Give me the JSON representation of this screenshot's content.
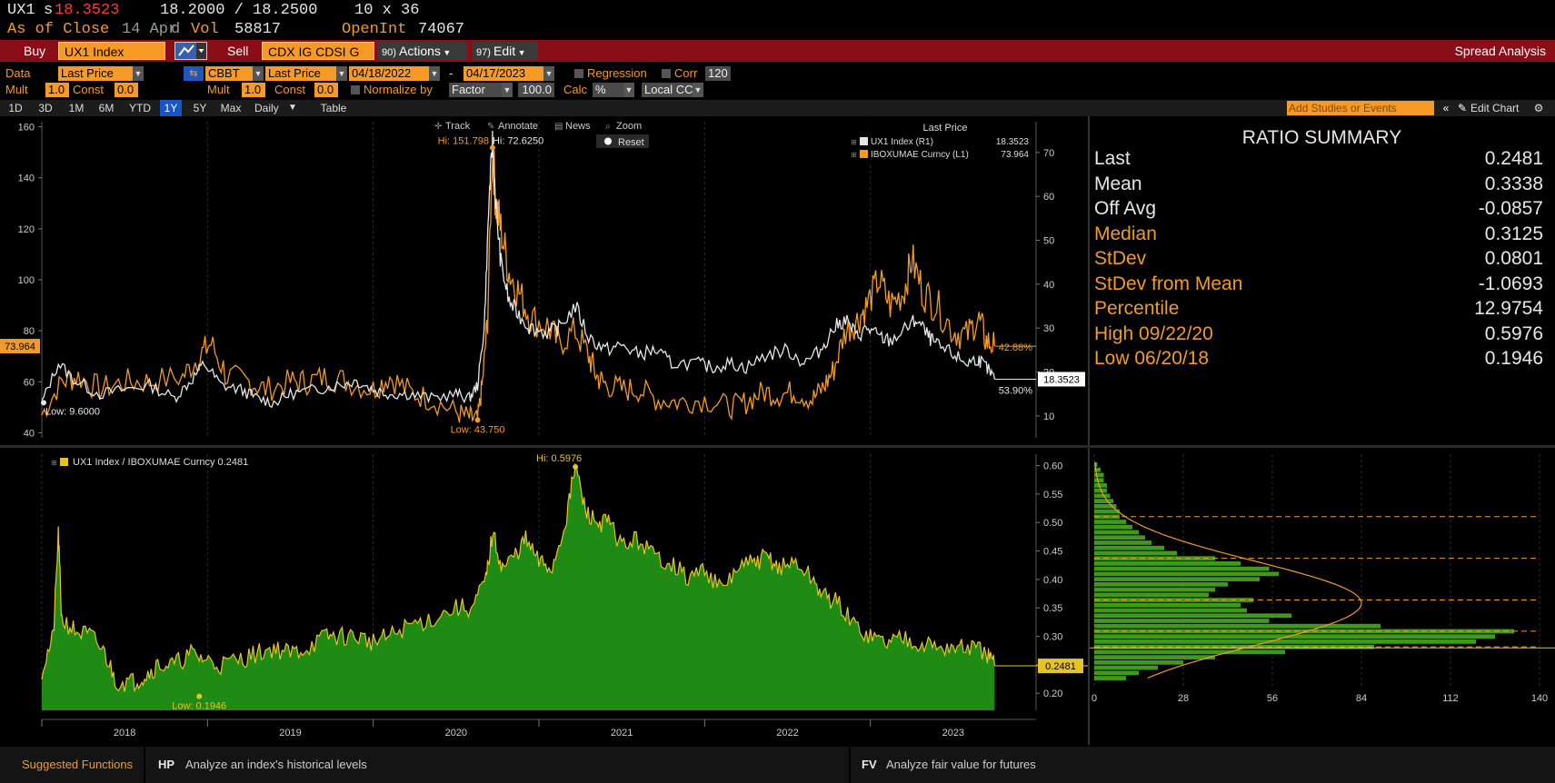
{
  "header": {
    "ticker": "UX1",
    "price_prefix": "s",
    "price": "18.3523",
    "bid_ask": "18.2000 / 18.2500",
    "size": "10 x 36",
    "close_label": "As of Close",
    "close_date": "14 Apr",
    "close_flag": "d",
    "vol_label": "Vol",
    "vol": "58817",
    "oi_label": "OpenInt",
    "oi": "74067"
  },
  "toolbar": {
    "buy_label": "Buy",
    "buy_security": "UX1 Index",
    "sell_label": "Sell",
    "sell_security": "CDX IG CDSI G",
    "actions_label": "Actions",
    "actions_num": "90",
    "edit_label": "Edit",
    "edit_num": "97",
    "title": "Spread Analysis"
  },
  "settings": {
    "data_label": "Data",
    "data_value": "Last Price",
    "source_value": "CBBT",
    "field_value": "Last Price",
    "start_date": "04/18/2022",
    "end_date": "04/17/2023",
    "dash": "-",
    "regression_label": "Regression",
    "corr_label": "Corr",
    "corr_value": "120",
    "mult_label": "Mult",
    "mult_value": "1.0",
    "const_label": "Const",
    "const_value": "0.0",
    "mult2_label": "Mult",
    "mult2_value": "1.0",
    "const2_label": "Const",
    "const2_value": "0.0",
    "normalize_label": "Normalize by",
    "normalize_value": "Factor",
    "factor_value": "100.0",
    "calc_label": "Calc",
    "calc_value": "%",
    "ccy_value": "Local CCY"
  },
  "periods": {
    "items": [
      "1D",
      "3D",
      "1M",
      "6M",
      "YTD",
      "1Y",
      "5Y",
      "Max"
    ],
    "selected": "1Y",
    "frequency": "Daily",
    "table_label": "Table",
    "add_studies": "Add Studies or Events",
    "collapse": "«",
    "edit_chart": "Edit Chart",
    "gear": "⚙"
  },
  "chart_tools": {
    "track": "Track",
    "annotate": "Annotate",
    "news": "News",
    "zoom": "Zoom",
    "reset": "Reset"
  },
  "colors": {
    "orange": "#f29a29",
    "white": "#e6e6e6",
    "green_fill": "#1f8a14",
    "yellow": "#e5c32a",
    "red_bar": "#8b0d17",
    "select_blue": "#1557c7"
  },
  "chart_data": [
    {
      "type": "line",
      "legend_title": "Last Price",
      "legend_position": "top-right",
      "series": [
        {
          "name": "UX1 Index  (R1)",
          "last": "18.3523",
          "color": "#e6e6e6",
          "axis": "right"
        },
        {
          "name": "IBOXUMAE Curncy  (L1)",
          "last": "73.964",
          "color": "#f29a29",
          "axis": "left"
        }
      ],
      "left_axis": {
        "ticks": [
          "40",
          "60",
          "80",
          "100",
          "120",
          "140",
          "160"
        ],
        "ylim": [
          38,
          162
        ]
      },
      "right_axis": {
        "ticks": [
          "10",
          "20",
          "30",
          "40",
          "50",
          "60",
          "70"
        ],
        "ylim": [
          5,
          77
        ]
      },
      "x_labels": [
        "2018",
        "2019",
        "2020",
        "2021",
        "2022",
        "2023"
      ],
      "x_domain": [
        2017.5,
        2023.5
      ],
      "annotations": {
        "hi_orange": "Hi: 151.798",
        "hi_white": "Hi: 72.6250",
        "low_white": "Low: 9.6000",
        "low_orange": "Low: 43.750",
        "pct_orange": "42.88%",
        "pct_white": "53.90%",
        "last_left": "73.964",
        "last_right": "18.3523"
      },
      "orange_points": [
        [
          2017.5,
          47
        ],
        [
          2017.62,
          60
        ],
        [
          2017.72,
          62
        ],
        [
          2017.85,
          57
        ],
        [
          2018.0,
          60
        ],
        [
          2018.15,
          60
        ],
        [
          2018.35,
          62
        ],
        [
          2018.45,
          70
        ],
        [
          2018.52,
          75
        ],
        [
          2018.62,
          62
        ],
        [
          2018.75,
          60
        ],
        [
          2018.85,
          57
        ],
        [
          2019.0,
          60
        ],
        [
          2019.1,
          60
        ],
        [
          2019.22,
          62
        ],
        [
          2019.35,
          60
        ],
        [
          2019.5,
          57
        ],
        [
          2019.6,
          62
        ],
        [
          2019.72,
          56
        ],
        [
          2019.85,
          53
        ],
        [
          2020.0,
          48
        ],
        [
          2020.08,
          46
        ],
        [
          2020.13,
          45
        ],
        [
          2020.16,
          60
        ],
        [
          2020.19,
          85
        ],
        [
          2020.22,
          151.8
        ],
        [
          2020.24,
          130
        ],
        [
          2020.27,
          120
        ],
        [
          2020.32,
          103
        ],
        [
          2020.38,
          95
        ],
        [
          2020.45,
          85
        ],
        [
          2020.55,
          82
        ],
        [
          2020.62,
          75
        ],
        [
          2020.72,
          80
        ],
        [
          2020.8,
          70
        ],
        [
          2020.85,
          62
        ],
        [
          2020.9,
          59
        ],
        [
          2021.0,
          57
        ],
        [
          2021.1,
          57
        ],
        [
          2021.22,
          53
        ],
        [
          2021.35,
          52
        ],
        [
          2021.5,
          53
        ],
        [
          2021.65,
          50
        ],
        [
          2021.75,
          52
        ],
        [
          2021.85,
          56
        ],
        [
          2021.95,
          55
        ],
        [
          2022.05,
          56
        ],
        [
          2022.15,
          53
        ],
        [
          2022.22,
          58
        ],
        [
          2022.28,
          65
        ],
        [
          2022.35,
          80
        ],
        [
          2022.42,
          84
        ],
        [
          2022.48,
          90
        ],
        [
          2022.55,
          100
        ],
        [
          2022.62,
          90
        ],
        [
          2022.7,
          95
        ],
        [
          2022.75,
          108
        ],
        [
          2022.82,
          95
        ],
        [
          2022.9,
          90
        ],
        [
          2023.0,
          80
        ],
        [
          2023.08,
          78
        ],
        [
          2023.15,
          85
        ],
        [
          2023.2,
          76
        ],
        [
          2023.25,
          73.964
        ]
      ],
      "white_points": [
        [
          2017.5,
          13
        ],
        [
          2017.6,
          22
        ],
        [
          2017.7,
          18
        ],
        [
          2017.85,
          15
        ],
        [
          2018.0,
          16
        ],
        [
          2018.15,
          17
        ],
        [
          2018.3,
          14
        ],
        [
          2018.4,
          18
        ],
        [
          2018.48,
          22
        ],
        [
          2018.58,
          17
        ],
        [
          2018.7,
          16
        ],
        [
          2018.8,
          14
        ],
        [
          2018.9,
          13
        ],
        [
          2019.0,
          15
        ],
        [
          2019.15,
          16
        ],
        [
          2019.28,
          17
        ],
        [
          2019.4,
          18
        ],
        [
          2019.5,
          16
        ],
        [
          2019.6,
          15
        ],
        [
          2019.72,
          15
        ],
        [
          2019.85,
          14
        ],
        [
          2020.0,
          15
        ],
        [
          2020.08,
          14
        ],
        [
          2020.13,
          17
        ],
        [
          2020.17,
          30
        ],
        [
          2020.2,
          60
        ],
        [
          2020.22,
          72.6
        ],
        [
          2020.24,
          58
        ],
        [
          2020.27,
          45
        ],
        [
          2020.32,
          36
        ],
        [
          2020.38,
          33
        ],
        [
          2020.45,
          30
        ],
        [
          2020.55,
          29
        ],
        [
          2020.62,
          30
        ],
        [
          2020.72,
          35
        ],
        [
          2020.8,
          28
        ],
        [
          2020.9,
          25
        ],
        [
          2021.0,
          26
        ],
        [
          2021.1,
          24
        ],
        [
          2021.2,
          25
        ],
        [
          2021.3,
          22
        ],
        [
          2021.45,
          22
        ],
        [
          2021.55,
          21
        ],
        [
          2021.65,
          22
        ],
        [
          2021.75,
          21
        ],
        [
          2021.88,
          24
        ],
        [
          2022.0,
          25
        ],
        [
          2022.1,
          22
        ],
        [
          2022.2,
          25
        ],
        [
          2022.28,
          30
        ],
        [
          2022.35,
          32
        ],
        [
          2022.42,
          28
        ],
        [
          2022.48,
          30
        ],
        [
          2022.55,
          28
        ],
        [
          2022.62,
          27
        ],
        [
          2022.72,
          30
        ],
        [
          2022.78,
          32
        ],
        [
          2022.85,
          28
        ],
        [
          2022.9,
          26
        ],
        [
          2023.0,
          24
        ],
        [
          2023.08,
          22
        ],
        [
          2023.15,
          23
        ],
        [
          2023.2,
          21
        ],
        [
          2023.25,
          18.35
        ]
      ]
    },
    {
      "type": "area",
      "legend_label": "UX1 Index / IBOXUMAE Curncy",
      "legend_value": "0.2481",
      "y_ticks": [
        "0.20",
        "0.25",
        "0.30",
        "0.35",
        "0.40",
        "0.45",
        "0.50",
        "0.55",
        "0.60"
      ],
      "ylim": [
        0.17,
        0.62
      ],
      "x_labels": [
        "2018",
        "2019",
        "2020",
        "2021",
        "2022",
        "2023"
      ],
      "x_domain": [
        2017.5,
        2023.5
      ],
      "annotations": {
        "hi": "Hi: 0.5976",
        "low": "Low: 0.1946",
        "last": "0.2481"
      },
      "points": [
        [
          2017.5,
          0.24
        ],
        [
          2017.57,
          0.3
        ],
        [
          2017.6,
          0.48
        ],
        [
          2017.62,
          0.33
        ],
        [
          2017.7,
          0.31
        ],
        [
          2017.8,
          0.3
        ],
        [
          2017.88,
          0.27
        ],
        [
          2017.95,
          0.22
        ],
        [
          2018.05,
          0.22
        ],
        [
          2018.12,
          0.23
        ],
        [
          2018.2,
          0.25
        ],
        [
          2018.3,
          0.25
        ],
        [
          2018.4,
          0.27
        ],
        [
          2018.48,
          0.26
        ],
        [
          2018.58,
          0.25
        ],
        [
          2018.7,
          0.26
        ],
        [
          2018.8,
          0.27
        ],
        [
          2018.9,
          0.28
        ],
        [
          2019.0,
          0.27
        ],
        [
          2019.1,
          0.28
        ],
        [
          2019.22,
          0.3
        ],
        [
          2019.3,
          0.3
        ],
        [
          2019.4,
          0.3
        ],
        [
          2019.5,
          0.29
        ],
        [
          2019.6,
          0.3
        ],
        [
          2019.72,
          0.32
        ],
        [
          2019.85,
          0.33
        ],
        [
          2020.0,
          0.35
        ],
        [
          2020.1,
          0.35
        ],
        [
          2020.18,
          0.4
        ],
        [
          2020.22,
          0.48
        ],
        [
          2020.28,
          0.42
        ],
        [
          2020.35,
          0.44
        ],
        [
          2020.42,
          0.47
        ],
        [
          2020.5,
          0.43
        ],
        [
          2020.58,
          0.42
        ],
        [
          2020.66,
          0.5
        ],
        [
          2020.72,
          0.6
        ],
        [
          2020.78,
          0.52
        ],
        [
          2020.85,
          0.5
        ],
        [
          2020.92,
          0.5
        ],
        [
          2021.0,
          0.46
        ],
        [
          2021.1,
          0.47
        ],
        [
          2021.2,
          0.44
        ],
        [
          2021.3,
          0.43
        ],
        [
          2021.4,
          0.4
        ],
        [
          2021.5,
          0.42
        ],
        [
          2021.6,
          0.38
        ],
        [
          2021.7,
          0.42
        ],
        [
          2021.8,
          0.43
        ],
        [
          2021.88,
          0.44
        ],
        [
          2021.95,
          0.42
        ],
        [
          2022.05,
          0.43
        ],
        [
          2022.15,
          0.4
        ],
        [
          2022.22,
          0.37
        ],
        [
          2022.3,
          0.36
        ],
        [
          2022.4,
          0.32
        ],
        [
          2022.5,
          0.3
        ],
        [
          2022.6,
          0.29
        ],
        [
          2022.7,
          0.3
        ],
        [
          2022.8,
          0.29
        ],
        [
          2022.9,
          0.28
        ],
        [
          2023.0,
          0.28
        ],
        [
          2023.1,
          0.28
        ],
        [
          2023.2,
          0.27
        ],
        [
          2023.25,
          0.2481
        ]
      ]
    },
    {
      "type": "bar",
      "orientation": "horizontal",
      "x_ticks": [
        "0",
        "28",
        "56",
        "84",
        "112",
        "140"
      ],
      "xlim": [
        0,
        140
      ],
      "bins": [
        [
          0.19,
          10
        ],
        [
          0.2,
          14
        ],
        [
          0.21,
          20
        ],
        [
          0.22,
          28
        ],
        [
          0.23,
          38
        ],
        [
          0.24,
          60
        ],
        [
          0.25,
          88
        ],
        [
          0.26,
          120
        ],
        [
          0.27,
          126
        ],
        [
          0.28,
          132
        ],
        [
          0.29,
          90
        ],
        [
          0.3,
          55
        ],
        [
          0.31,
          62
        ],
        [
          0.32,
          48
        ],
        [
          0.33,
          46
        ],
        [
          0.34,
          50
        ],
        [
          0.35,
          36
        ],
        [
          0.36,
          38
        ],
        [
          0.37,
          42
        ],
        [
          0.38,
          52
        ],
        [
          0.39,
          58
        ],
        [
          0.4,
          55
        ],
        [
          0.41,
          46
        ],
        [
          0.42,
          38
        ],
        [
          0.43,
          26
        ],
        [
          0.44,
          22
        ],
        [
          0.45,
          18
        ],
        [
          0.46,
          16
        ],
        [
          0.47,
          14
        ],
        [
          0.48,
          12
        ],
        [
          0.49,
          10
        ],
        [
          0.5,
          8
        ],
        [
          0.51,
          8
        ],
        [
          0.52,
          7
        ],
        [
          0.53,
          6
        ],
        [
          0.54,
          5
        ],
        [
          0.55,
          4
        ],
        [
          0.56,
          4
        ],
        [
          0.57,
          3
        ],
        [
          0.58,
          3
        ],
        [
          0.59,
          2
        ],
        [
          0.6,
          1
        ]
      ],
      "normal_curve": {
        "mean": 0.3338,
        "stdev": 0.0801,
        "peak": 84
      },
      "dashed_levels": [
        0.25,
        0.28,
        0.34,
        0.42,
        0.5
      ]
    }
  ],
  "summary": {
    "title": "RATIO SUMMARY",
    "rows": [
      {
        "label": "Last",
        "value": "0.2481",
        "color": "#e6e6e6"
      },
      {
        "label": "Mean",
        "value": "0.3338",
        "color": "#e6e6e6"
      },
      {
        "label": "Off Avg",
        "value": "-0.0857",
        "color": "#e6e6e6"
      },
      {
        "label": "Median",
        "value": "0.3125",
        "color": "#f29a29"
      },
      {
        "label": "StDev",
        "value": "0.0801",
        "color": "#f29a29"
      },
      {
        "label": "StDev from Mean",
        "value": "-1.0693",
        "color": "#f29a29"
      },
      {
        "label": "Percentile",
        "value": "12.9754",
        "color": "#f29a29"
      },
      {
        "label": "High 09/22/20",
        "value": "0.5976",
        "color": "#f29a29"
      },
      {
        "label": "Low 06/20/18",
        "value": "0.1946",
        "color": "#f29a29"
      }
    ]
  },
  "bottom": {
    "suggested": "Suggested Functions",
    "hp_code": "HP",
    "hp_desc": "Analyze an index's historical levels",
    "fv_code": "FV",
    "fv_desc": "Analyze fair value for futures"
  }
}
